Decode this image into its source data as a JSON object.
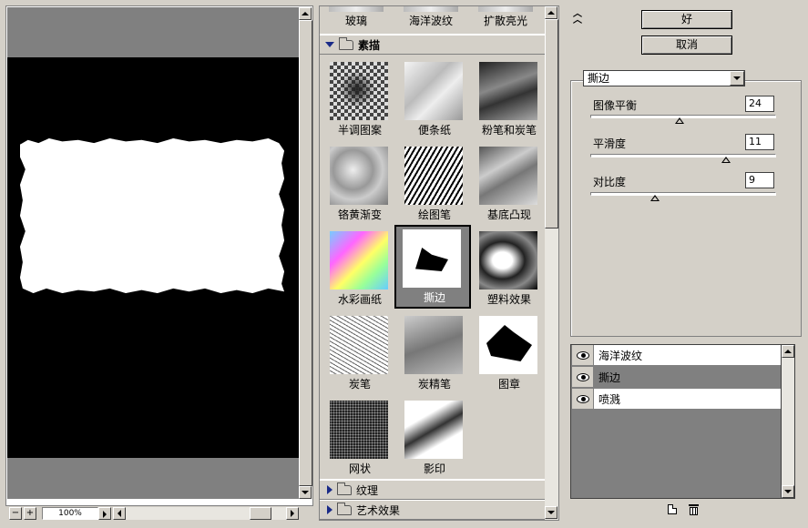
{
  "preview": {
    "zoom_label": "100%",
    "minus_label": "−",
    "plus_label": "+"
  },
  "gallery": {
    "top_row": [
      "玻璃",
      "海洋波纹",
      "扩散亮光"
    ],
    "open_category": "素描",
    "filters": [
      {
        "label": "半调图案",
        "selected": false
      },
      {
        "label": "便条纸",
        "selected": false
      },
      {
        "label": "粉笔和炭笔",
        "selected": false
      },
      {
        "label": "铬黄渐变",
        "selected": false
      },
      {
        "label": "绘图笔",
        "selected": false
      },
      {
        "label": "基底凸现",
        "selected": false
      },
      {
        "label": "水彩画纸",
        "selected": false
      },
      {
        "label": "撕边",
        "selected": true
      },
      {
        "label": "塑料效果",
        "selected": false
      },
      {
        "label": "炭笔",
        "selected": false
      },
      {
        "label": "炭精笔",
        "selected": false
      },
      {
        "label": "图章",
        "selected": false
      },
      {
        "label": "网状",
        "selected": false
      },
      {
        "label": "影印",
        "selected": false
      }
    ],
    "closed_categories": [
      "纹理",
      "艺术效果"
    ]
  },
  "buttons": {
    "ok_label": "好",
    "cancel_label": "取消"
  },
  "settings": {
    "filter_select_value": "撕边",
    "params": [
      {
        "label": "图像平衡",
        "value": "24",
        "fraction": 0.48
      },
      {
        "label": "平滑度",
        "value": "11",
        "fraction": 0.73
      },
      {
        "label": "对比度",
        "value": "9",
        "fraction": 0.35
      }
    ]
  },
  "layers": [
    {
      "name": "海洋波纹",
      "active": false
    },
    {
      "name": "撕边",
      "active": true
    },
    {
      "name": "喷溅",
      "active": false
    }
  ],
  "icons": [
    "collapse-icon",
    "eye-icon",
    "folder-icon",
    "new-layer-icon",
    "delete-layer-icon",
    "dropdown-arrow-icon"
  ]
}
